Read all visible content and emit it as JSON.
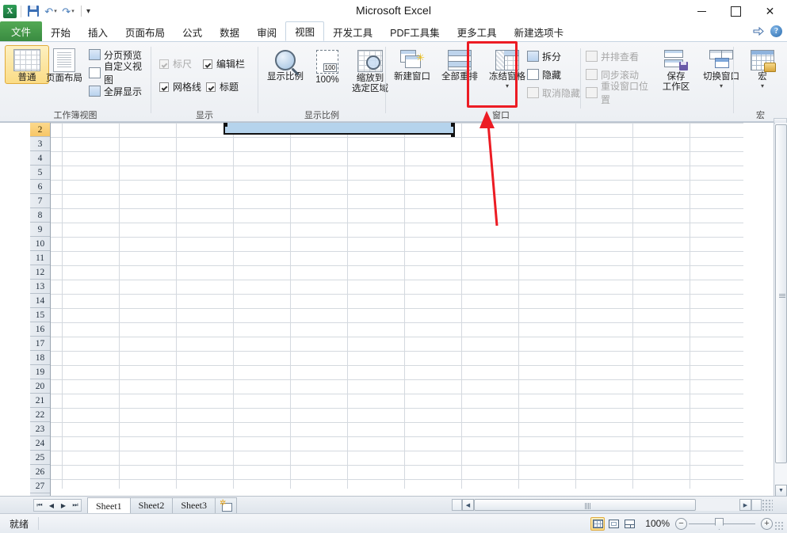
{
  "window": {
    "title": "Microsoft Excel",
    "minimize_label": "—",
    "maximize_label": "□",
    "close_label": "✕"
  },
  "quick_access": {
    "logo_label": "X",
    "save_name": "save-icon",
    "undo_label": "↶",
    "redo_label": "↷",
    "customize_label": "▾"
  },
  "tabs": [
    {
      "label": "文件",
      "state": "file"
    },
    {
      "label": "开始",
      "state": "normal"
    },
    {
      "label": "插入",
      "state": "normal"
    },
    {
      "label": "页面布局",
      "state": "normal"
    },
    {
      "label": "公式",
      "state": "normal"
    },
    {
      "label": "数据",
      "state": "normal"
    },
    {
      "label": "审阅",
      "state": "normal"
    },
    {
      "label": "视图",
      "state": "active"
    },
    {
      "label": "开发工具",
      "state": "normal"
    },
    {
      "label": "PDF工具集",
      "state": "normal"
    },
    {
      "label": "更多工具",
      "state": "normal"
    },
    {
      "label": "新建选项卡",
      "state": "normal"
    }
  ],
  "tab_right": {
    "collapse_ribbon": "collapse-ribbon-icon",
    "help_label": "?"
  },
  "ribbon": {
    "groups": [
      {
        "name": "workbook-views",
        "label": "工作簿视图",
        "big_buttons": [
          {
            "label": "普通",
            "selected": true
          },
          {
            "label": "页面布局",
            "selected": false
          }
        ],
        "small_items": [
          {
            "label": "分页预览",
            "disabled": false
          },
          {
            "label": "自定义视图",
            "disabled": false
          },
          {
            "label": "全屏显示",
            "disabled": false
          }
        ]
      },
      {
        "name": "show",
        "label": "显示",
        "checkboxes": [
          {
            "label": "标尺",
            "checked": true,
            "disabled": true
          },
          {
            "label": "编辑栏",
            "checked": true,
            "disabled": false
          },
          {
            "label": "网格线",
            "checked": true,
            "disabled": false
          },
          {
            "label": "标题",
            "checked": true,
            "disabled": false
          }
        ]
      },
      {
        "name": "zoom",
        "label": "显示比例",
        "big_buttons": [
          {
            "label": "显示比例"
          },
          {
            "label": "100%"
          },
          {
            "label": "缩放到\n选定区域"
          }
        ],
        "zoom_to_selection_line1": "缩放到",
        "zoom_to_selection_line2": "选定区域"
      },
      {
        "name": "window",
        "label": "窗口",
        "big_buttons": [
          {
            "label": "新建窗口"
          },
          {
            "label": "全部重排"
          },
          {
            "label": "冻结窗格",
            "highlighted": true,
            "has_dropdown": true
          }
        ],
        "small_items_left": [
          {
            "label": "拆分",
            "disabled": false
          },
          {
            "label": "隐藏",
            "disabled": false
          },
          {
            "label": "取消隐藏",
            "disabled": true
          }
        ],
        "small_items_right": [
          {
            "label": "并排查看",
            "disabled": true
          },
          {
            "label": "同步滚动",
            "disabled": true
          },
          {
            "label": "重设窗口位置",
            "disabled": true
          }
        ],
        "save_workspace_line1": "保存",
        "save_workspace_line2": "工作区",
        "switch_windows_label": "切换窗口"
      },
      {
        "name": "macros",
        "label": "宏",
        "big_buttons": [
          {
            "label": "宏",
            "has_dropdown": true
          }
        ]
      }
    ]
  },
  "annotation": {
    "highlight_target": "冻结窗格",
    "highlight_color": "#ec1c24",
    "arrow_color": "#ec1c24"
  },
  "grid": {
    "row_headers": [
      "2",
      "3",
      "4",
      "5",
      "6",
      "7",
      "8",
      "9",
      "10",
      "11",
      "12",
      "13",
      "14",
      "15",
      "16",
      "17",
      "18",
      "19",
      "20",
      "21",
      "22",
      "23",
      "24",
      "25",
      "26",
      "27"
    ],
    "selected_row": "2",
    "selection_fill_color": "#b5d3ec"
  },
  "sheet_bar": {
    "nav_first": "⏮",
    "nav_prev": "◀",
    "nav_next": "▶",
    "nav_last": "⏭",
    "sheets": [
      {
        "label": "Sheet1",
        "active": true
      },
      {
        "label": "Sheet2",
        "active": false
      },
      {
        "label": "Sheet3",
        "active": false
      }
    ],
    "new_sheet_name": "insert-worksheet-icon"
  },
  "status_bar": {
    "ready_text": "就绪",
    "view_buttons": [
      {
        "name": "normal-view",
        "active": true
      },
      {
        "name": "page-layout-view",
        "active": false
      },
      {
        "name": "page-break-preview",
        "active": false
      }
    ],
    "zoom_percent": "100%",
    "zoom_out_label": "−",
    "zoom_in_label": "+"
  }
}
